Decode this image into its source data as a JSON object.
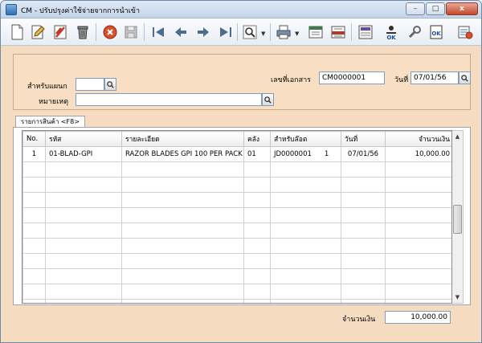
{
  "window": {
    "title": "CM - ปรับปรุงค่าใช้จ่ายจากการนำเข้า",
    "minimize_label": "–",
    "maximize_label": "□",
    "close_label": "x"
  },
  "toolbar": {
    "icons": [
      "new-document-icon",
      "edit-icon",
      "delete-icon",
      "trash-icon",
      "cancel-icon",
      "save-icon",
      "first-record-icon",
      "previous-record-icon",
      "next-record-icon",
      "last-record-icon",
      "search-icon",
      "print-icon",
      "export-icon",
      "import-icon",
      "calculator-icon",
      "approve-icon",
      "tools-icon",
      "ok-document-icon",
      "settings-icon"
    ]
  },
  "header": {
    "department_label": "สำหรับแผนก",
    "department_value": "",
    "remark_label": "หมายเหตุ",
    "remark_value": "",
    "doc_no_label": "เลขที่เอกสาร",
    "doc_no_value": "CM0000001",
    "date_label": "วันที่",
    "date_value": "07/01/56"
  },
  "tab": {
    "label": "รายการสินค้า <F8>"
  },
  "table": {
    "columns": [
      "No.",
      "รหัส",
      "รายละเอียด",
      "คลัง",
      "สำหรับล๊อต",
      "วันที่",
      "จำนวนเงิน"
    ],
    "rows": [
      {
        "no": "1",
        "code": "01-BLAD-GPI",
        "desc": "RAZOR BLADES GPI 100 PER PACK",
        "wh": "01",
        "lot": "JD0000001",
        "lot_no": "1",
        "date": "07/01/56",
        "amount": "10,000.00"
      }
    ],
    "empty_rows": 10
  },
  "footer": {
    "total_label": "จำนวนเงิน",
    "total_value": "10,000.00"
  }
}
